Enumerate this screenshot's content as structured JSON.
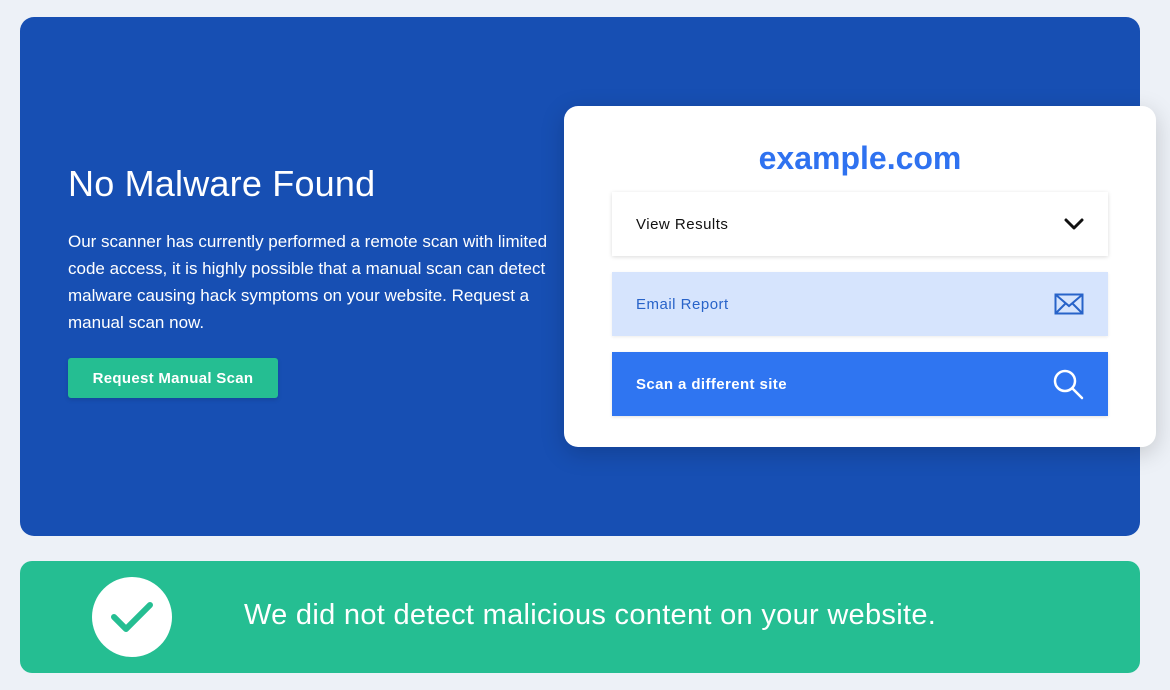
{
  "hero": {
    "title": "No Malware Found",
    "description": "Our scanner has currently performed a remote scan with limited code access, it is highly possible that a manual scan can detect malware causing hack symptoms on your website. Request a manual scan now.",
    "button_label": "Request Manual Scan"
  },
  "card": {
    "site": "example.com",
    "results_label": "View Results",
    "results_icon": "chevron-down-icon",
    "email_label": "Email Report",
    "email_icon": "envelope-icon",
    "scan_label": "Scan a different site",
    "scan_icon": "search-icon"
  },
  "banner": {
    "icon": "checkmark-icon",
    "message": "We did not detect malicious content on your website."
  },
  "colors": {
    "page_background": "#edf1f7",
    "hero_background": "#174fb3",
    "accent_green": "#25be92",
    "brand_blue": "#2f72f0",
    "email_row_background": "#d6e4fd"
  }
}
